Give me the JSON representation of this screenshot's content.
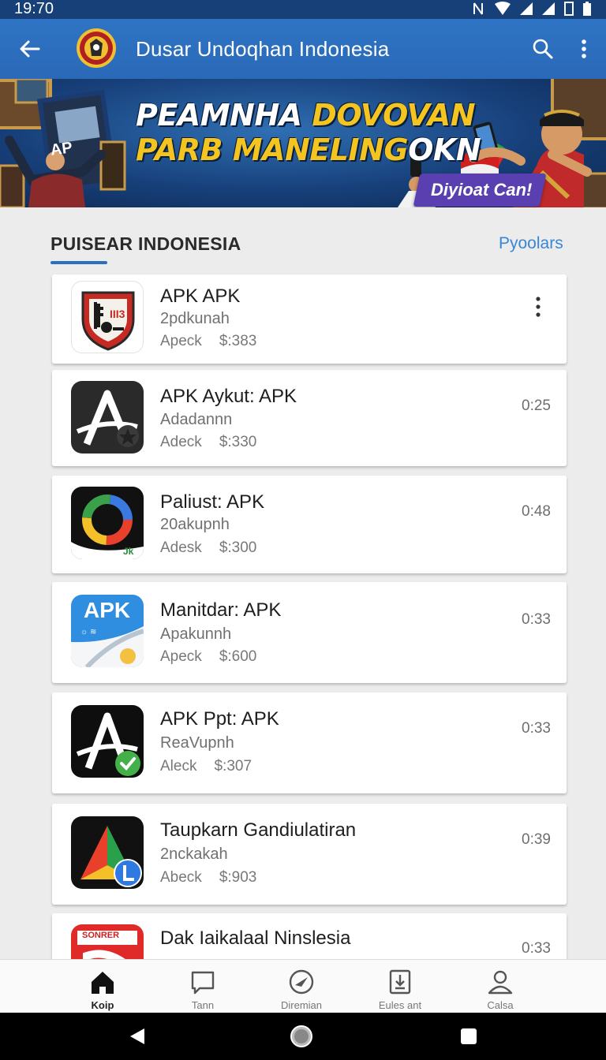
{
  "status_bar": {
    "time": "19:70"
  },
  "app_bar": {
    "title": "Dusar Undoqhan Indonesia"
  },
  "banner": {
    "headline_line1_white": "PEAMNHA ",
    "headline_line1_yellow": "DOVOVAN",
    "headline_line2_yellow": "PARB MANELING",
    "headline_line2_white": "OKN",
    "cta": "Diyioat Can!",
    "label_left": "AP"
  },
  "section": {
    "title": "PUISEAR INDONESIA",
    "link": "Pyoolars"
  },
  "apps": [
    {
      "name": "APK APK",
      "sub": "2pdkunah",
      "meta_a": "Apeck",
      "meta_b": "$:383",
      "time": "",
      "icon": "shield-crest-icon"
    },
    {
      "name": "APK Aykut: APK",
      "sub": "Adadannn",
      "meta_a": "Adeck",
      "meta_b": "$:330",
      "time": "0:25",
      "icon": "letter-a-dark-icon"
    },
    {
      "name": "Paliust: APK",
      "sub": "20akupnh",
      "meta_a": "Adesk",
      "meta_b": "$:300",
      "time": "0:48",
      "icon": "color-ring-icon"
    },
    {
      "name": "Manitdar: APK",
      "sub": "Apakunnh",
      "meta_a": "Apeck",
      "meta_b": "$:600",
      "time": "0:33",
      "icon": "apk-blue-icon",
      "icon_text": "APK"
    },
    {
      "name": "APK Ppt: APK",
      "sub": "ReaVupnh",
      "meta_a": "Aleck",
      "meta_b": "$:307",
      "time": "0:33",
      "icon": "letter-a-check-icon"
    },
    {
      "name": "Taupkarn Gandiulatiran",
      "sub": "2nckakah",
      "meta_a": "Abeck",
      "meta_b": "$:903",
      "time": "0:39",
      "icon": "triangle-l-icon"
    },
    {
      "name": "Dak Iaikalaal Ninslesia",
      "sub": "",
      "meta_a": "",
      "meta_b": "",
      "time": "0:33",
      "icon": "red-banner-icon",
      "icon_text": "SONRER"
    }
  ],
  "bottom_nav": [
    {
      "label": "Koip",
      "icon": "home-icon",
      "active": true
    },
    {
      "label": "Tann",
      "icon": "chat-icon",
      "active": false
    },
    {
      "label": "Diremian",
      "icon": "compass-icon",
      "active": false
    },
    {
      "label": "Eules ant",
      "icon": "download-icon",
      "active": false
    },
    {
      "label": "Calsa",
      "icon": "profile-icon",
      "active": false
    }
  ],
  "colors": {
    "app_bar": "#2f74c4",
    "accent": "#3a86d6",
    "banner_yellow": "#f4c520",
    "cta": "#5a3fb0"
  }
}
